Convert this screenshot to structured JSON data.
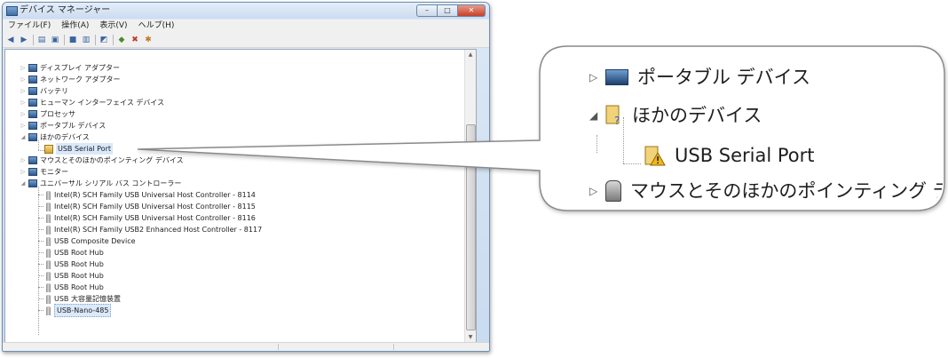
{
  "window": {
    "title": "デバイス マネージャー",
    "caption_buttons": [
      "–",
      "□",
      "✕"
    ]
  },
  "menu": [
    "ファイル(F)",
    "操作(A)",
    "表示(V)",
    "ヘルプ(H)"
  ],
  "toolbar_icons": [
    "back-icon",
    "forward-icon",
    "properties-icon",
    "help-icon",
    "scan-hardware-icon",
    "update-driver-icon",
    "uninstall-icon",
    "disable-icon"
  ],
  "tree": {
    "items": [
      {
        "label": "ディスプレイ アダプター",
        "level": 0,
        "expander": "▷"
      },
      {
        "label": "ネットワーク アダプター",
        "level": 0,
        "expander": "▷"
      },
      {
        "label": "バッテリ",
        "level": 0,
        "expander": "▷"
      },
      {
        "label": "ヒューマン インターフェイス デバイス",
        "level": 0,
        "expander": "▷"
      },
      {
        "label": "プロセッサ",
        "level": 0,
        "expander": "▷"
      },
      {
        "label": "ポータブル デバイス",
        "level": 0,
        "expander": "▷"
      },
      {
        "label": "ほかのデバイス",
        "level": 0,
        "expander": "◢"
      },
      {
        "label": "USB Serial Port",
        "level": 1,
        "expander": ""
      },
      {
        "label": "マウスとそのほかのポインティング デバイス",
        "level": 0,
        "expander": "▷"
      },
      {
        "label": "モニター",
        "level": 0,
        "expander": "▷"
      },
      {
        "label": "ユニバーサル シリアル バス コントローラー",
        "level": 0,
        "expander": "◢"
      },
      {
        "label": "Intel(R) SCH Family USB Universal Host Controller - 8114",
        "level": 1,
        "expander": ""
      },
      {
        "label": "Intel(R) SCH Family USB Universal Host Controller - 8115",
        "level": 1,
        "expander": ""
      },
      {
        "label": "Intel(R) SCH Family USB Universal Host Controller - 8116",
        "level": 1,
        "expander": ""
      },
      {
        "label": "Intel(R) SCH Family USB2 Enhanced Host Controller - 8117",
        "level": 1,
        "expander": ""
      },
      {
        "label": "USB Composite Device",
        "level": 1,
        "expander": ""
      },
      {
        "label": "USB Root Hub",
        "level": 1,
        "expander": ""
      },
      {
        "label": "USB Root Hub",
        "level": 1,
        "expander": ""
      },
      {
        "label": "USB Root Hub",
        "level": 1,
        "expander": ""
      },
      {
        "label": "USB Root Hub",
        "level": 1,
        "expander": ""
      },
      {
        "label": "USB 大容量記憶装置",
        "level": 1,
        "expander": ""
      },
      {
        "label": "USB-Nano-485",
        "level": 1,
        "expander": ""
      }
    ]
  },
  "callout": {
    "rows": [
      {
        "label": "ポータブル デバイス",
        "expander": "▷"
      },
      {
        "label": "ほかのデバイス",
        "expander": "◢"
      },
      {
        "label": "USB Serial Port",
        "expander": ""
      },
      {
        "label": "マウスとそのほかのポインティング デバイス",
        "expander": "▷"
      }
    ]
  },
  "colors": {
    "selection": "#dbe9fb",
    "warning": "#e8b623",
    "titlebar": "#cddcf0"
  }
}
